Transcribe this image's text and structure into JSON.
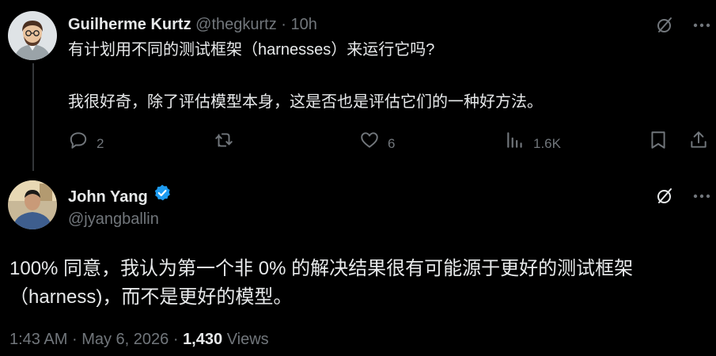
{
  "parent": {
    "author_name": "Guilherme Kurtz",
    "handle": "@thegkurtz",
    "separator": "·",
    "time": "10h",
    "text_line1": "有计划用不同的测试框架（harnesses）来运行它吗?",
    "text_line2": "我很好奇，除了评估模型本身，这是否也是评估它们的一种好方法。",
    "reply_count": "2",
    "like_count": "6",
    "view_count": "1.6K",
    "more_glyph": "···"
  },
  "reply": {
    "author_name": "John Yang",
    "handle": "@jyangballin",
    "text_line1": "100% 同意，我认为第一个非 0% 的解决结果很有可能源于更好的测试框架",
    "text_line2": "（harness)，而不是更好的模型。",
    "time": "1:43 AM",
    "separator1": "·",
    "date": "May 6, 2026",
    "separator2": "·",
    "views_count": "1,430",
    "views_label": "Views",
    "more_glyph": "···"
  },
  "colors": {
    "background": "#000000",
    "text": "#e7e9ea",
    "muted": "#71767b",
    "verified": "#1d9bf0",
    "thread_line": "#333639"
  },
  "icons": [
    "grok-icon",
    "more-icon",
    "reply-icon",
    "retweet-icon",
    "like-icon",
    "views-icon",
    "bookmark-icon",
    "share-icon",
    "verified-badge-icon"
  ]
}
